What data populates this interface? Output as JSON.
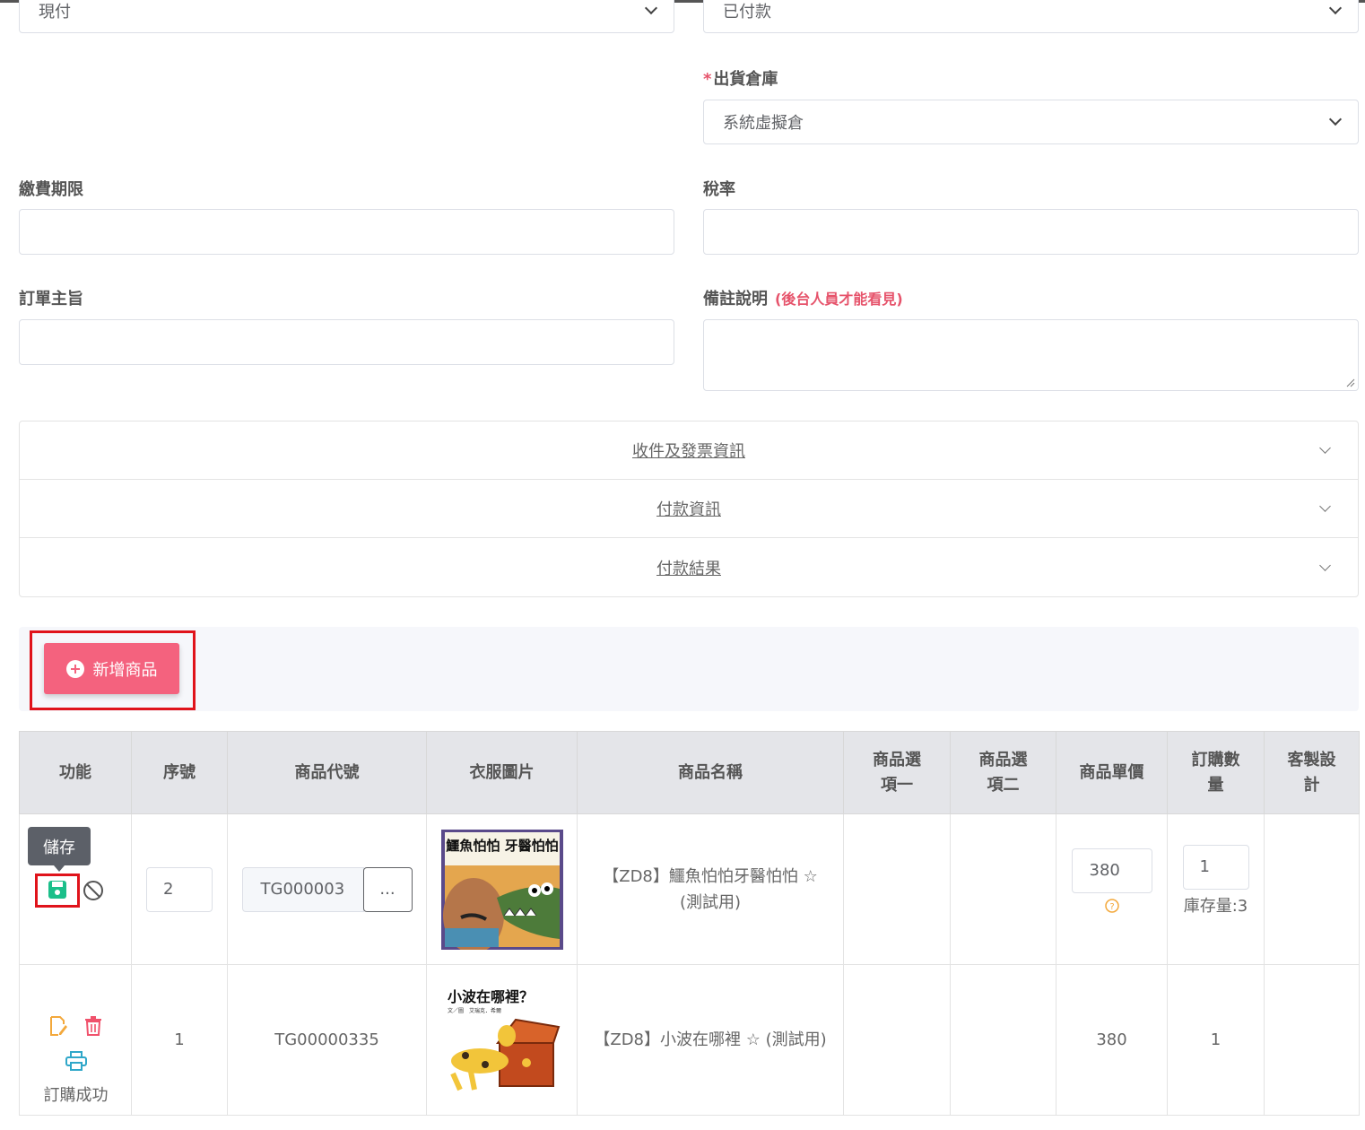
{
  "form": {
    "payment_method_value": "現付",
    "payment_status_value": "已付款",
    "warehouse": {
      "required_mark": "*",
      "label": "出貨倉庫",
      "value": "系統虛擬倉"
    },
    "due_date": {
      "label": "繳費期限",
      "value": ""
    },
    "tax_rate": {
      "label": "稅率",
      "value": ""
    },
    "order_subject": {
      "label": "訂單主旨",
      "value": ""
    },
    "remarks": {
      "label": "備註說明",
      "hint": "(後台人員才能看見)",
      "value": ""
    }
  },
  "accordion": [
    "收件及發票資訊",
    "付款資訊",
    "付款結果"
  ],
  "toolbar": {
    "add_button_label": "新增商品"
  },
  "table": {
    "headers": {
      "function": "功能",
      "seq": "序號",
      "code": "商品代號",
      "image": "衣服圖片",
      "name": "商品名稱",
      "option1": "商品選項一",
      "option2": "商品選項二",
      "price": "商品單價",
      "qty": "訂購數量",
      "custom": "客製設計"
    },
    "rows": [
      {
        "tooltip": "儲存",
        "seq": "2",
        "code": "TG000003",
        "lookup_label": "...",
        "image": {
          "title": "鱷魚怕怕 牙醫怕怕"
        },
        "name": "【ZD8】鱷魚怕怕牙醫怕怕 ☆ (測試用)",
        "price": "380",
        "qty": "1",
        "stock": "庫存量:3"
      },
      {
        "seq": "1",
        "code": "TG00000335",
        "image": {
          "title": "小波在哪裡？",
          "subtitle": "文／圖　艾瑞克．希爾"
        },
        "name": "【ZD8】小波在哪裡 ☆ (測試用)",
        "price": "380",
        "qty": "1",
        "status": "訂購成功"
      }
    ]
  },
  "colors": {
    "accent": "#f4627e",
    "save_green": "#1bbf8a",
    "edit_orange": "#f3a83b",
    "delete_red": "#f0526c",
    "print_teal": "#2fa7c9",
    "highlight_red": "#e0131b"
  },
  "icons": [
    "chevron-down-icon",
    "plus-circle-icon",
    "save-icon",
    "cancel-icon",
    "question-icon",
    "edit-icon",
    "trash-icon",
    "print-icon"
  ]
}
